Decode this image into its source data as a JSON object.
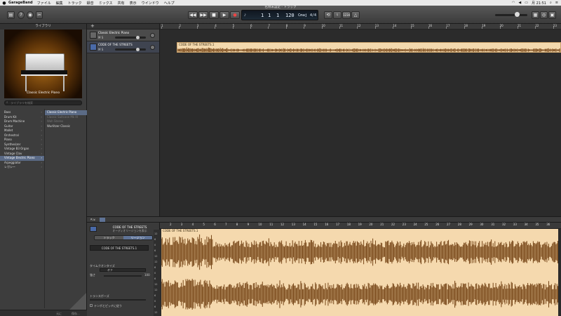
{
  "menubar": {
    "apple": "",
    "app_name": "GarageBand",
    "items": [
      "ファイル",
      "編集",
      "トラック",
      "録音",
      "ミックス",
      "共有",
      "表示",
      "ウインドウ",
      "ヘルプ"
    ],
    "clock": "月 21:51"
  },
  "window": {
    "title": "名称未設定 - トラック"
  },
  "toolbar": {
    "library_icon": "library-icon",
    "rewind": "◀◀",
    "forward": "▶▶",
    "stop": "■",
    "play": "▶",
    "record": "●",
    "lcd": {
      "bar": "1",
      "beat": "1",
      "tick": "1",
      "tempo": "120",
      "key": "Cmaj",
      "signature": "4/4"
    },
    "count": "1234"
  },
  "library": {
    "header": "ライブラリ",
    "instrument_caption": "Classic Electric Piano",
    "search_placeholder": "ライブラリを検索",
    "categories": [
      {
        "label": "Bass",
        "selected": false
      },
      {
        "label": "Drum Kit",
        "selected": false
      },
      {
        "label": "Drum Machine",
        "selected": false
      },
      {
        "label": "Guitar",
        "selected": false
      },
      {
        "label": "Mallet",
        "selected": false
      },
      {
        "label": "Orchestral",
        "selected": false
      },
      {
        "label": "Piano",
        "selected": false
      },
      {
        "label": "Synthesizer",
        "selected": false
      },
      {
        "label": "Vintage B3 Organ",
        "selected": false
      },
      {
        "label": "Vintage Clav",
        "selected": false
      },
      {
        "label": "Vintage Electric Piano",
        "selected": true
      },
      {
        "label": "Arpeggiator",
        "selected": false
      },
      {
        "label": "レガシー",
        "selected": false
      }
    ],
    "patches": [
      {
        "label": "Classic Electric Piano",
        "state": "selected"
      },
      {
        "label": "Classic Suitcase Mk III",
        "state": "dim"
      },
      {
        "label": "Wah Stereo",
        "state": "dim"
      },
      {
        "label": "Wurlitzer Classic",
        "state": "normal"
      }
    ],
    "footer_left": "元に",
    "footer_right": "保存..."
  },
  "tracks": [
    {
      "name": "Classic Electric Piano",
      "controls": "M S",
      "icon": "piano-icon"
    },
    {
      "name": "CODE OF THE STREETS",
      "controls": "M S",
      "icon": "waveform-icon"
    }
  ],
  "ruler": {
    "bars": [
      "1",
      "2",
      "3",
      "4",
      "5",
      "6",
      "7",
      "8",
      "9",
      "10",
      "11",
      "12",
      "13",
      "14",
      "15",
      "16",
      "17",
      "18",
      "19",
      "20",
      "21",
      "22",
      "23"
    ]
  },
  "region": {
    "name": "CODE OF THE STREETS.1"
  },
  "editor": {
    "title": "CODE OF THE STREETS",
    "subtitle": "オーディオリージョンを表示",
    "tabs": [
      {
        "label": "トラック",
        "active": false
      },
      {
        "label": "リージョン",
        "active": true
      }
    ],
    "region_name": "CODE OF THE STREETS.1",
    "time_quantize_label": "タイムクオンタイズ",
    "time_quantize_value": "オフ",
    "pitch_label": "強さ",
    "pitch_value": "100",
    "transpose_label": "トランスポーズ",
    "flex_label": "テンポとピッチに従う",
    "region_label": "CODE OF THE STREETS.1",
    "ruler": [
      "2",
      "3",
      "4",
      "5",
      "6",
      "7",
      "8",
      "9",
      "10",
      "11",
      "12",
      "13",
      "14",
      "15",
      "16",
      "17",
      "18",
      "19",
      "20",
      "21",
      "22",
      "23",
      "24",
      "25",
      "26",
      "27",
      "28",
      "29",
      "30",
      "31",
      "32",
      "33",
      "34",
      "35",
      "36"
    ]
  },
  "colors": {
    "region_fill": "#f3d9ae",
    "waveform": "#7a4a1c",
    "selection": "#5a6a86"
  }
}
